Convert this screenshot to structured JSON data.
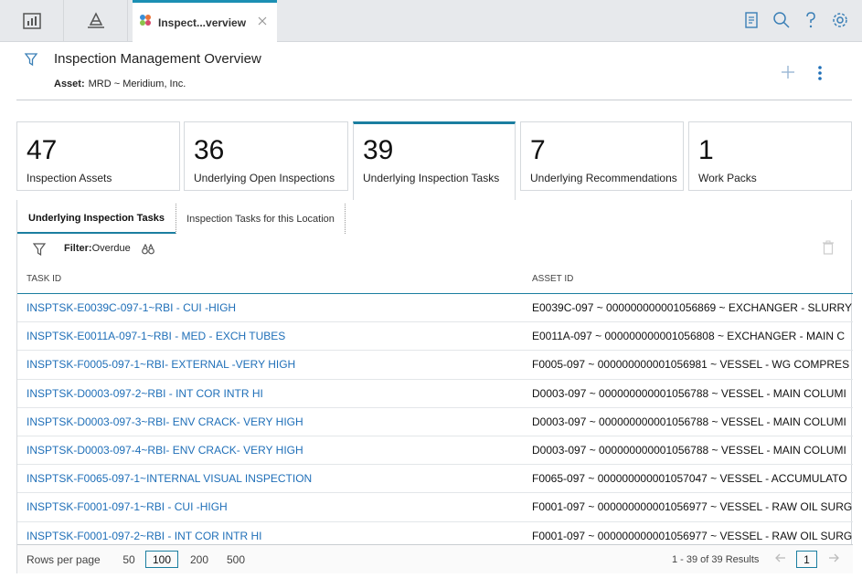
{
  "topbar": {
    "active_tab_label": "Inspect...verview",
    "icons": [
      "dashboard-icon",
      "asset-hierarchy-icon",
      "module-icon",
      "close-icon",
      "clipboard-icon",
      "search-icon",
      "help-icon",
      "settings-icon"
    ]
  },
  "header": {
    "title": "Inspection Management Overview",
    "asset_label": "Asset:",
    "asset_value": "MRD ~ Meridium, Inc."
  },
  "cards": [
    {
      "value": "47",
      "label": "Inspection Assets"
    },
    {
      "value": "36",
      "label": "Underlying Open Inspections"
    },
    {
      "value": "39",
      "label": "Underlying Inspection Tasks"
    },
    {
      "value": "7",
      "label": "Underlying Recommendations"
    },
    {
      "value": "1",
      "label": "Work Packs"
    }
  ],
  "subtabs": [
    "Underlying Inspection Tasks",
    "Inspection Tasks for this Location"
  ],
  "filter": {
    "label": "Filter:",
    "value": "Overdue"
  },
  "table": {
    "columns": [
      "TASK ID",
      "ASSET ID"
    ],
    "rows": [
      {
        "task": "INSPTSK-E0039C-097-1~RBI - CUI -HIGH",
        "asset": "E0039C-097 ~ 000000000001056869 ~ EXCHANGER - SLURRY"
      },
      {
        "task": "INSPTSK-E0011A-097-1~RBI - MED - EXCH TUBES",
        "asset": "E0011A-097 ~ 000000000001056808 ~ EXCHANGER - MAIN C"
      },
      {
        "task": "INSPTSK-F0005-097-1~RBI- EXTERNAL -VERY HIGH",
        "asset": "F0005-097 ~ 000000000001056981 ~ VESSEL - WG COMPRES"
      },
      {
        "task": "INSPTSK-D0003-097-2~RBI - INT COR INTR HI",
        "asset": "D0003-097 ~ 000000000001056788 ~ VESSEL - MAIN COLUMI"
      },
      {
        "task": "INSPTSK-D0003-097-3~RBI- ENV CRACK- VERY HIGH",
        "asset": "D0003-097 ~ 000000000001056788 ~ VESSEL - MAIN COLUMI"
      },
      {
        "task": "INSPTSK-D0003-097-4~RBI- ENV CRACK- VERY HIGH",
        "asset": "D0003-097 ~ 000000000001056788 ~ VESSEL - MAIN COLUMI"
      },
      {
        "task": "INSPTSK-F0065-097-1~INTERNAL VISUAL INSPECTION",
        "asset": "F0065-097 ~ 000000000001057047 ~ VESSEL - ACCUMULATO"
      },
      {
        "task": "INSPTSK-F0001-097-1~RBI - CUI -HIGH",
        "asset": "F0001-097 ~ 000000000001056977 ~ VESSEL - RAW OIL SURG"
      },
      {
        "task": "INSPTSK-F0001-097-2~RBI - INT COR INTR HI",
        "asset": "F0001-097 ~ 000000000001056977 ~ VESSEL - RAW OIL SURG"
      }
    ]
  },
  "footer": {
    "rows_per_page_label": "Rows per page",
    "options": [
      "50",
      "100",
      "200",
      "500"
    ],
    "selected_option": "100",
    "results": "1 - 39 of 39 Results",
    "page": "1"
  },
  "colors": {
    "accent": "#1b7ea0",
    "link": "#1f6fb8"
  }
}
